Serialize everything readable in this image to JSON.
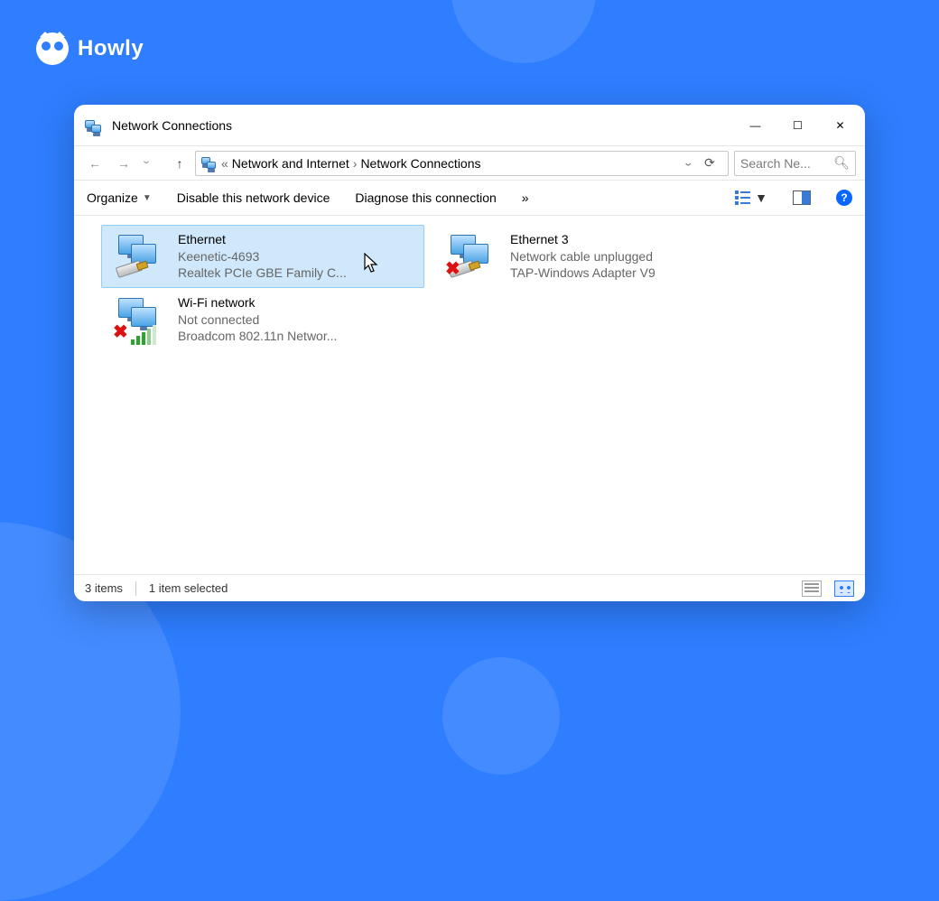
{
  "brand": {
    "name": "Howly"
  },
  "window": {
    "title": "Network Connections",
    "controls": {
      "minimize": "—",
      "maximize": "☐",
      "close": "✕"
    }
  },
  "nav": {
    "back": "←",
    "forward": "→",
    "recent": "⌄",
    "up": "↑",
    "path_prefix": "«",
    "path": [
      "Network and Internet",
      "Network Connections"
    ],
    "dropdown": "⌄",
    "refresh": "⟳",
    "search_placeholder": "Search Ne..."
  },
  "toolbar": {
    "organize": "Organize",
    "disable": "Disable this network device",
    "diagnose": "Diagnose this connection",
    "more": "»",
    "help": "?"
  },
  "items": [
    {
      "name": "Ethernet",
      "status": "Keenetic-4693",
      "device": "Realtek PCIe GBE Family C...",
      "selected": true,
      "overlay": "none"
    },
    {
      "name": "Ethernet 3",
      "status": "Network cable unplugged",
      "device": "TAP-Windows Adapter V9",
      "selected": false,
      "overlay": "x"
    },
    {
      "name": "Wi-Fi network",
      "status": "Not connected",
      "device": "Broadcom 802.11n Networ...",
      "selected": false,
      "overlay": "wifi-x"
    }
  ],
  "status": {
    "count": "3 items",
    "selected": "1 item selected"
  }
}
